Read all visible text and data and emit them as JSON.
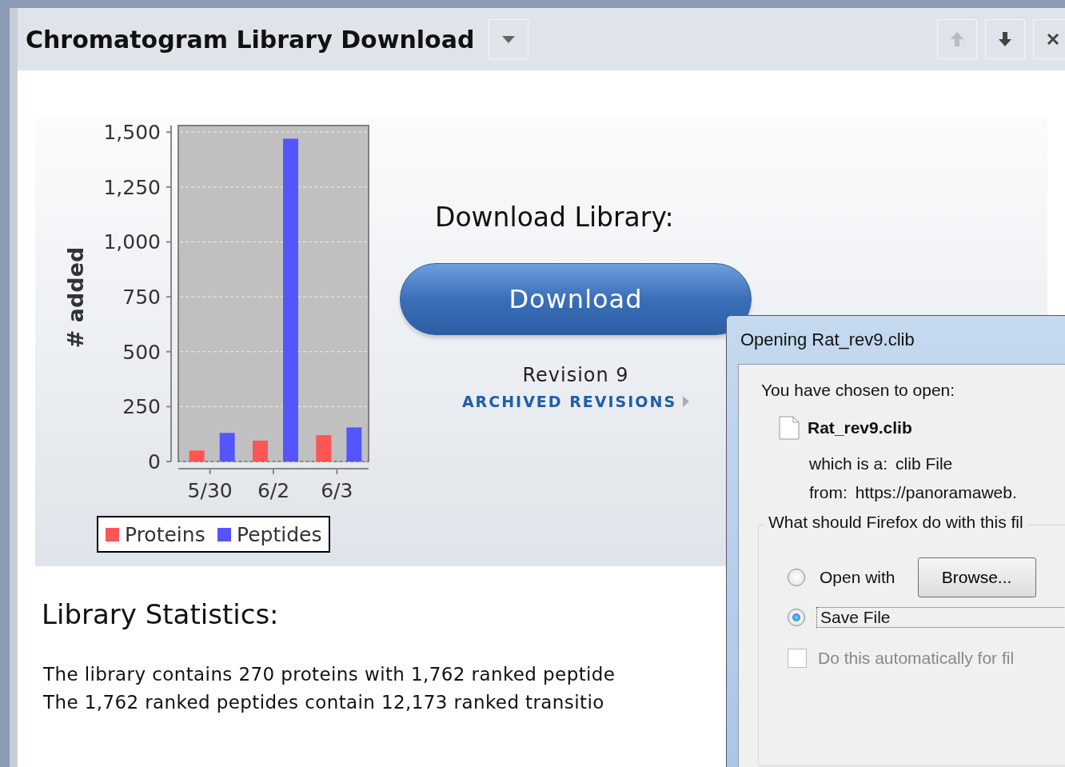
{
  "window": {
    "title": "Chromatogram Library Download",
    "header_buttons": [
      {
        "kind": "up",
        "disabled": true
      },
      {
        "kind": "down",
        "disabled": false
      },
      {
        "kind": "close",
        "disabled": false
      }
    ]
  },
  "chart": {
    "chart_data": {
      "type": "bar",
      "ylabel": "# added",
      "categories": [
        "5/30",
        "6/2",
        "6/3"
      ],
      "series": [
        {
          "name": "Proteins",
          "color": "#ff5555",
          "values": [
            50,
            95,
            120
          ]
        },
        {
          "name": "Peptides",
          "color": "#5555ff",
          "values": [
            130,
            1470,
            155
          ]
        }
      ],
      "ylim": [
        0,
        1530
      ],
      "grid": true,
      "legend": true,
      "yticks": [
        {
          "value": 0,
          "label": "0"
        },
        {
          "value": 250,
          "label": "250"
        },
        {
          "value": 500,
          "label": "500"
        },
        {
          "value": 750,
          "label": "750"
        },
        {
          "value": 1000,
          "label": "1,000"
        },
        {
          "value": 1250,
          "label": "1,250"
        },
        {
          "value": 1500,
          "label": "1,500"
        }
      ]
    }
  },
  "download": {
    "heading": "Download Library:",
    "button": "Download",
    "revision": "Revision 9",
    "archived_link": "ARCHIVED REVISIONS"
  },
  "statistics": {
    "heading": "Library Statistics:",
    "lines": [
      "The library contains 270 proteins with 1,762 ranked peptide",
      "The 1,762 ranked peptides contain 12,173 ranked transitio"
    ]
  },
  "dialog": {
    "title": "Opening Rat_rev9.clib",
    "intro": "You have chosen to open:",
    "file_name": "Rat_rev9.clib",
    "type_label": "which is a:",
    "type_value": "clib File",
    "from_label": "from:",
    "from_value": "https://panoramaweb.",
    "group_label": "What should Firefox do with this fil",
    "options": [
      {
        "label": "Open with",
        "selected": false,
        "button": "Browse..."
      },
      {
        "label": "Save File",
        "selected": true
      }
    ],
    "auto_checkbox": {
      "label": "Do this automatically for fil",
      "checked": false,
      "disabled": true
    }
  }
}
